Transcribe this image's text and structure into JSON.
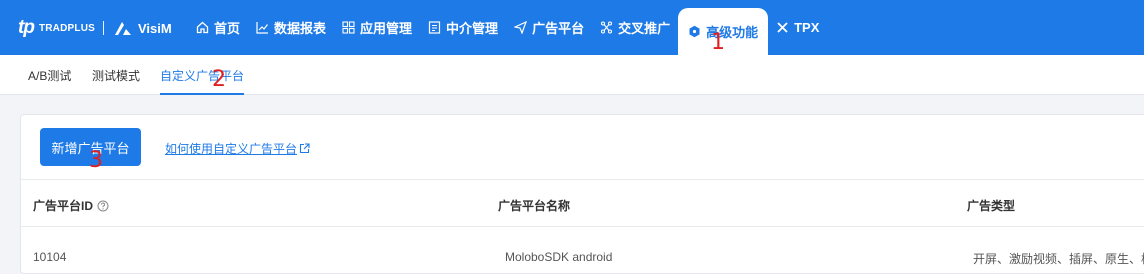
{
  "logo": {
    "tradplus": "TRADPLUS",
    "visim": "VisiM"
  },
  "nav": {
    "items": [
      {
        "label": "首页",
        "icon": "home-icon"
      },
      {
        "label": "数据报表",
        "icon": "chart-line-icon"
      },
      {
        "label": "应用管理",
        "icon": "grid-icon"
      },
      {
        "label": "中介管理",
        "icon": "document-icon"
      },
      {
        "label": "广告平台",
        "icon": "send-icon"
      },
      {
        "label": "交叉推广",
        "icon": "cross-promo-icon"
      },
      {
        "label": "高级功能",
        "icon": "hexagon-icon",
        "active": true
      },
      {
        "label": "TPX",
        "icon": "x-icon"
      }
    ]
  },
  "subnav": {
    "tabs": [
      {
        "label": "A/B测试"
      },
      {
        "label": "测试模式"
      },
      {
        "label": "自定义广告平台",
        "active": true
      }
    ]
  },
  "main": {
    "add_button": "新增广告平台",
    "help_link": "如何使用自定义广告平台",
    "table": {
      "columns": [
        "广告平台ID",
        "广告平台名称",
        "广告类型"
      ],
      "first_row": [
        "10104",
        "MoloboSDK android",
        "开屏、激励视频、插屏、原生、横幅"
      ]
    }
  },
  "annotations": {
    "marker_1": "1",
    "marker_2": "2",
    "marker_3": "3"
  },
  "colors": {
    "brand": "#1e7ae6",
    "marker": "#e02020"
  }
}
